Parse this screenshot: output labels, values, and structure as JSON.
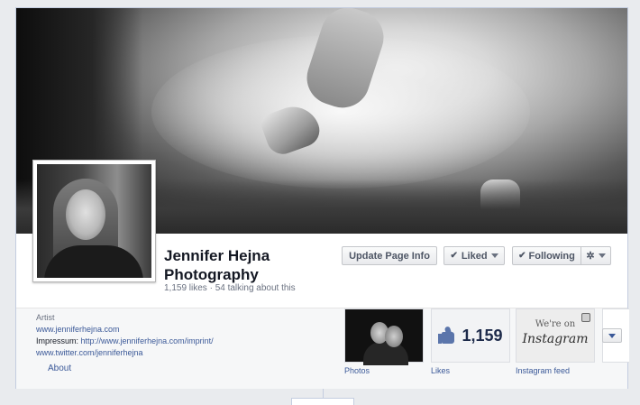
{
  "page": {
    "name": "Jennifer Hejna Photography",
    "stats": "1,159 likes · 54 talking about this"
  },
  "actions": {
    "update_label": "Update Page Info",
    "liked_label": "Liked",
    "following_label": "Following",
    "check_glyph": "✔",
    "gear_glyph": "✲"
  },
  "about": {
    "category": "Artist",
    "website": "www.jenniferhejna.com",
    "impressum_label": "Impressum:",
    "impressum_url": "http://www.jenniferhejna.com/imprint/",
    "twitter": "www.twitter.com/jenniferhejna",
    "about_link": "About"
  },
  "apps": {
    "photos_label": "Photos",
    "likes_count": "1,159",
    "likes_label": "Likes",
    "instagram_line1": "We're on",
    "instagram_line2": "Instagram",
    "instagram_label": "Instagram feed"
  },
  "icons": {
    "thumb": "thumbs-up-icon",
    "gear": "gear-icon",
    "check": "check-icon",
    "caret": "chevron-down-icon",
    "instagram": "camera-icon"
  },
  "colors": {
    "link": "#3b5998",
    "text": "#141823",
    "muted": "#6a7180"
  }
}
